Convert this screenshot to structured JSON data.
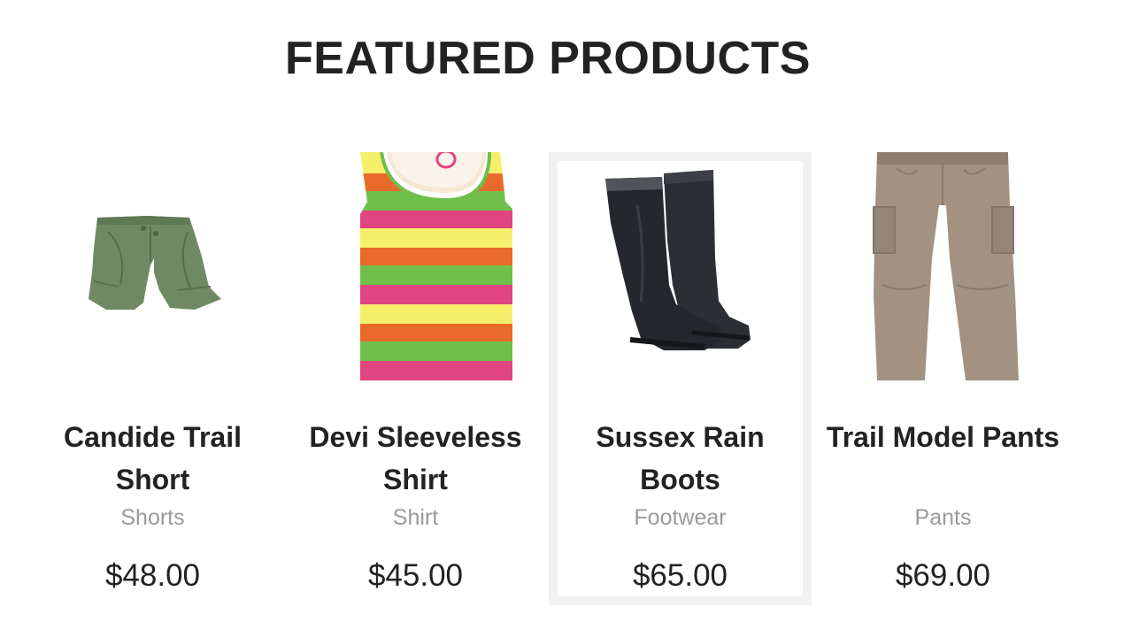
{
  "section": {
    "title": "FEATURED PRODUCTS"
  },
  "products": [
    {
      "name": "Candide Trail Short",
      "category": "Shorts",
      "price": "$48.00",
      "image_icon": "shorts-image",
      "color": "#6f8a62"
    },
    {
      "name": "Devi Sleeveless Shirt",
      "category": "Shirt",
      "price": "$45.00",
      "image_icon": "striped-tank-top-image",
      "color": "#e0457f"
    },
    {
      "name": "Sussex Rain Boots",
      "category": "Footwear",
      "price": "$65.00",
      "image_icon": "rain-boots-image",
      "color": "#2b2e33",
      "highlighted": true
    },
    {
      "name": "Trail Model Pants",
      "category": "Pants",
      "price": "$69.00",
      "image_icon": "cargo-pants-image",
      "color": "#a39282"
    }
  ],
  "colors": {
    "highlight_border": "#f1f1f1",
    "text": "#222222",
    "muted_text": "#9a9a9a"
  }
}
